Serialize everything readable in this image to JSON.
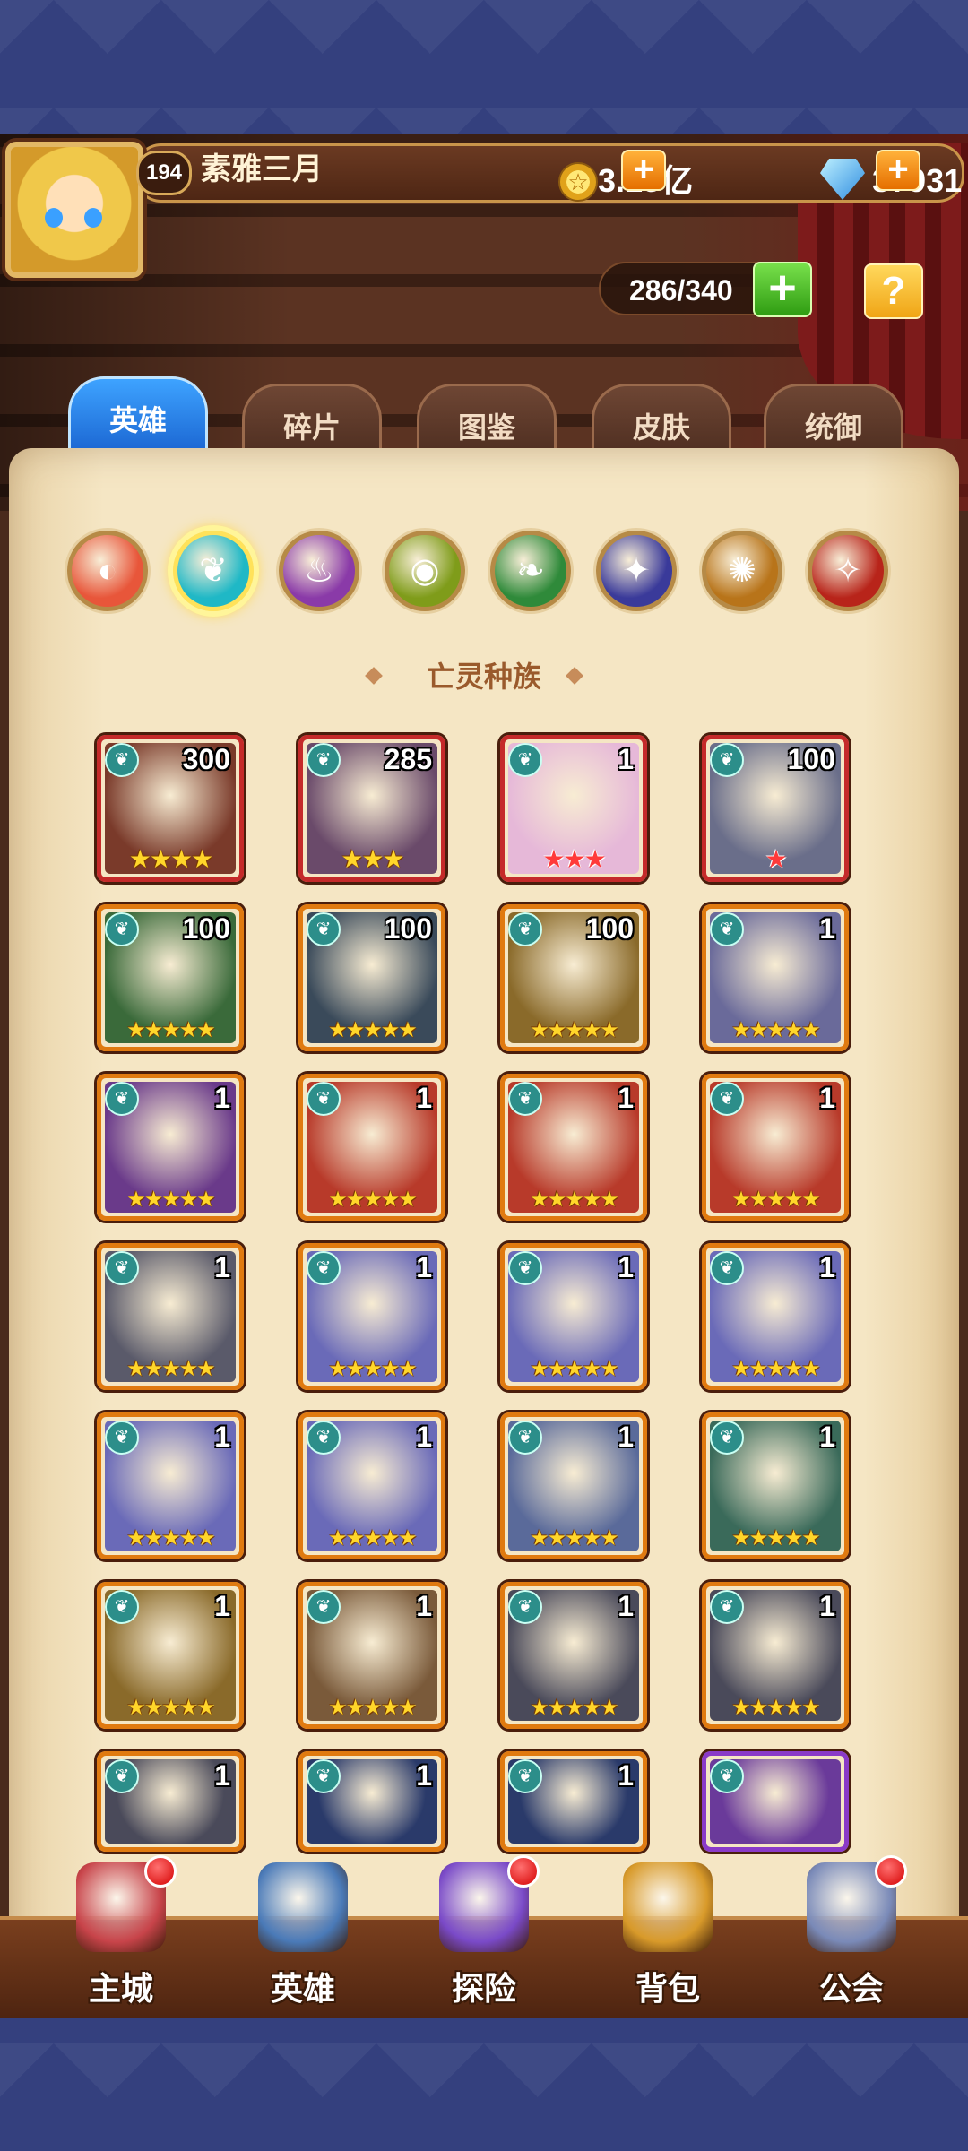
{
  "player": {
    "level": "194",
    "name": "素雅三月",
    "gold": "3.15亿",
    "gems": "37931"
  },
  "hero_capacity": "286/340",
  "help_label": "?",
  "tabs": [
    {
      "label": "英雄",
      "active": true
    },
    {
      "label": "碎片",
      "active": false
    },
    {
      "label": "图鉴",
      "active": false
    },
    {
      "label": "皮肤",
      "active": false
    },
    {
      "label": "统御",
      "active": false
    }
  ],
  "factions": [
    {
      "icon": "all-factions-icon",
      "color": "#e8563a",
      "selected": false
    },
    {
      "icon": "undead-icon",
      "color": "#1fb8c6",
      "selected": true
    },
    {
      "icon": "demon-icon",
      "color": "#8a3aa8",
      "selected": false
    },
    {
      "icon": "forest-icon",
      "color": "#7f9c1a",
      "selected": false
    },
    {
      "icon": "nature-icon",
      "color": "#2f8a3a",
      "selected": false
    },
    {
      "icon": "dark-icon",
      "color": "#3a3a9a",
      "selected": false
    },
    {
      "icon": "light-icon",
      "color": "#b8741a",
      "selected": false
    },
    {
      "icon": "chaos-icon",
      "color": "#b8241a",
      "selected": false
    }
  ],
  "section_title": "亡灵种族",
  "heroes": [
    {
      "count": "300",
      "stars": "★★★★",
      "star_color": "gold",
      "frame": "#c52a2a",
      "bg": "#7a3a2a"
    },
    {
      "count": "285",
      "stars": "★★★",
      "star_color": "gold",
      "frame": "#c52a2a",
      "bg": "#6a4a6a"
    },
    {
      "count": "1",
      "stars": "★★★",
      "star_color": "red",
      "frame": "#c52a2a",
      "bg": "#e6b8d8"
    },
    {
      "count": "100",
      "stars": "★",
      "star_color": "red",
      "frame": "#c52a2a",
      "bg": "#6a6e8a"
    },
    {
      "count": "100",
      "stars": "★★★★★",
      "star_color": "gold",
      "frame": "#e07a10",
      "bg": "#3a6a3a"
    },
    {
      "count": "100",
      "stars": "★★★★★",
      "star_color": "gold",
      "frame": "#e07a10",
      "bg": "#3a4a5a"
    },
    {
      "count": "100",
      "stars": "★★★★★",
      "star_color": "gold",
      "frame": "#e07a10",
      "bg": "#8a6a2a"
    },
    {
      "count": "1",
      "stars": "★★★★★",
      "star_color": "gold",
      "frame": "#e07a10",
      "bg": "#6a6a9a"
    },
    {
      "count": "1",
      "stars": "★★★★★",
      "star_color": "gold",
      "frame": "#e07a10",
      "bg": "#6a3a8a"
    },
    {
      "count": "1",
      "stars": "★★★★★",
      "star_color": "gold",
      "frame": "#e07a10",
      "bg": "#b83a2a"
    },
    {
      "count": "1",
      "stars": "★★★★★",
      "star_color": "gold",
      "frame": "#e07a10",
      "bg": "#b83a2a"
    },
    {
      "count": "1",
      "stars": "★★★★★",
      "star_color": "gold",
      "frame": "#e07a10",
      "bg": "#b83a2a"
    },
    {
      "count": "1",
      "stars": "★★★★★",
      "star_color": "gold",
      "frame": "#e07a10",
      "bg": "#5a5a6a"
    },
    {
      "count": "1",
      "stars": "★★★★★",
      "star_color": "gold",
      "frame": "#e07a10",
      "bg": "#6a6ab8"
    },
    {
      "count": "1",
      "stars": "★★★★★",
      "star_color": "gold",
      "frame": "#e07a10",
      "bg": "#6a6ab8"
    },
    {
      "count": "1",
      "stars": "★★★★★",
      "star_color": "gold",
      "frame": "#e07a10",
      "bg": "#6a6ab8"
    },
    {
      "count": "1",
      "stars": "★★★★★",
      "star_color": "gold",
      "frame": "#e07a10",
      "bg": "#6a6ab8"
    },
    {
      "count": "1",
      "stars": "★★★★★",
      "star_color": "gold",
      "frame": "#e07a10",
      "bg": "#6a6ab8"
    },
    {
      "count": "1",
      "stars": "★★★★★",
      "star_color": "gold",
      "frame": "#e07a10",
      "bg": "#5a6a9a"
    },
    {
      "count": "1",
      "stars": "★★★★★",
      "star_color": "gold",
      "frame": "#e07a10",
      "bg": "#3a6a5a"
    },
    {
      "count": "1",
      "stars": "★★★★★",
      "star_color": "gold",
      "frame": "#e07a10",
      "bg": "#8a6a2a"
    },
    {
      "count": "1",
      "stars": "★★★★★",
      "star_color": "gold",
      "frame": "#e07a10",
      "bg": "#7a5a3a"
    },
    {
      "count": "1",
      "stars": "★★★★★",
      "star_color": "gold",
      "frame": "#e07a10",
      "bg": "#4a4a5a"
    },
    {
      "count": "1",
      "stars": "★★★★★",
      "star_color": "gold",
      "frame": "#e07a10",
      "bg": "#4a4a5a"
    },
    {
      "count": "1",
      "stars": "",
      "star_color": "gold",
      "frame": "#e07a10",
      "bg": "#4a4a5a"
    },
    {
      "count": "1",
      "stars": "",
      "star_color": "gold",
      "frame": "#e07a10",
      "bg": "#2a3a6a"
    },
    {
      "count": "1",
      "stars": "",
      "star_color": "gold",
      "frame": "#e07a10",
      "bg": "#2a3a6a"
    },
    {
      "count": "",
      "stars": "",
      "star_color": "gold",
      "frame": "#8a3ac8",
      "bg": "#6a3a9a"
    }
  ],
  "nav": [
    {
      "label": "主城",
      "icon": "castle-icon",
      "color": "#c8444a",
      "dot": true
    },
    {
      "label": "英雄",
      "icon": "hero-portrait-icon",
      "color": "#4a7ab8",
      "dot": false
    },
    {
      "label": "探险",
      "icon": "portal-icon",
      "color": "#7a4ac8",
      "dot": true
    },
    {
      "label": "背包",
      "icon": "backpack-icon",
      "color": "#d89a2a",
      "dot": false
    },
    {
      "label": "公会",
      "icon": "guild-tower-icon",
      "color": "#7a8ab8",
      "dot": true
    }
  ]
}
